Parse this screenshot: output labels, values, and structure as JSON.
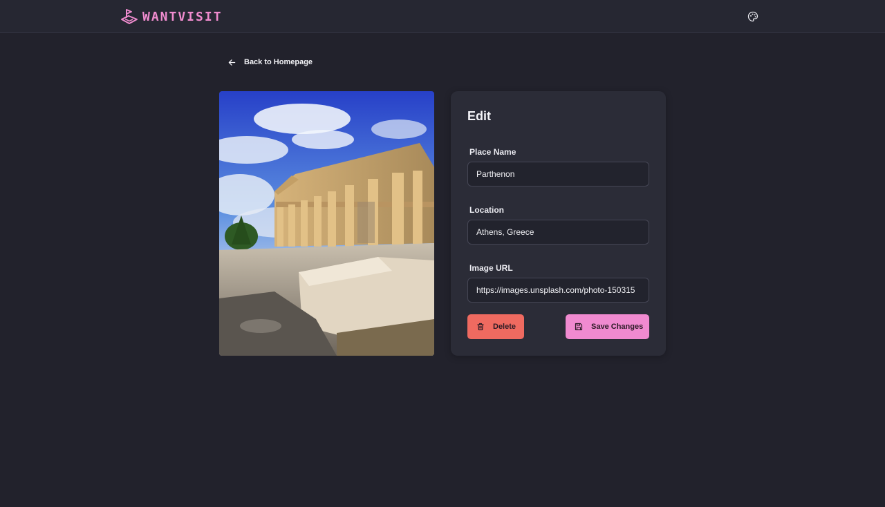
{
  "brand": {
    "name": "WANTVISIT",
    "color": "#f08ccf",
    "logo_icon": "pin-stack-icon"
  },
  "header": {
    "theme_icon": "palette-icon"
  },
  "back": {
    "label": "Back to Homepage",
    "icon": "arrow-left-icon"
  },
  "photo": {
    "subject": "parthenon-photo"
  },
  "edit_form": {
    "title": "Edit",
    "fields": [
      {
        "label": "Place Name",
        "value": "Parthenon"
      },
      {
        "label": "Location",
        "value": "Athens, Greece"
      },
      {
        "label": "Image URL",
        "value": "https://images.unsplash.com/photo-150315"
      }
    ],
    "delete_label": "Delete",
    "save_label": "Save Changes"
  },
  "colors": {
    "background": "#22222c",
    "card": "#2b2c37",
    "delete": "#ef6a60",
    "save": "#f08ad0"
  }
}
